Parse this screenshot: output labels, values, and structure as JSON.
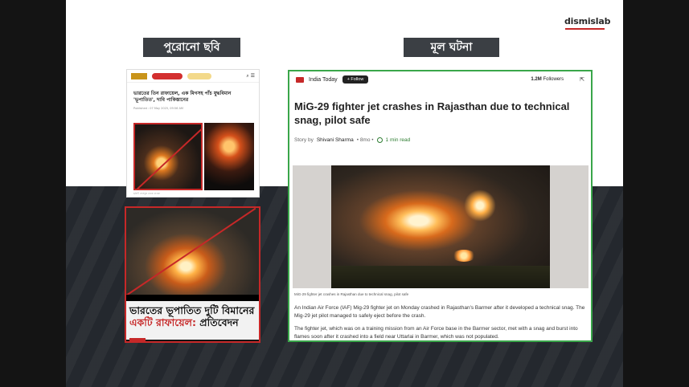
{
  "brand": "dismislab",
  "labels": {
    "old_image": "পুরোনো ছবি",
    "actual_event": "মূল ঘটনা"
  },
  "old_article": {
    "title": "ভারতের তিন রাফায়েল, এক মিগসহ পাঁচ যুদ্ধবিমান 'ভূপাতিত', দাবি পাকিস্তানের",
    "meta": "Published : 07 May 2025, 09:56 AM",
    "caption": "ছবিটি ফেসবুক থেকে নেওয়া"
  },
  "news_card": {
    "line1": "ভারতের ভূপাতিত দুটি বিমানের",
    "line2_red": "একটি রাফায়েল:",
    "line2_rest": " প্রতিবেদন"
  },
  "article": {
    "source": "India Today",
    "follow_label": "+ Follow",
    "followers_count": "1.2M",
    "followers_label": "Followers",
    "title": "MiG-29 fighter jet crashes in Rajasthan due to technical snag, pilot safe",
    "byline_prefix": "Story by",
    "author": "Shivani Sharma",
    "age": "• 8mo •",
    "read_time": "1 min read",
    "photo_caption": "MiG-29 fighter jet crashes in Rajasthan due to technical snag, pilot safe",
    "paragraphs": [
      "An Indian Air Force (IAF) Mig-29 fighter jet on Monday crashed in Rajasthan's Barmer after it developed a technical snag. The Mig-29 jet pilot managed to safely eject before the crash.",
      "The fighter jet, which was on a training mission from an Air Force base in the Barmer sector, met with a snag and burst into flames soon after it crashed into a field near Uttarlai in Barmer, which was not populated."
    ]
  },
  "colors": {
    "accent_red": "#c62828",
    "frame_green": "#3aa64a",
    "label_bg": "#3b3f44"
  }
}
